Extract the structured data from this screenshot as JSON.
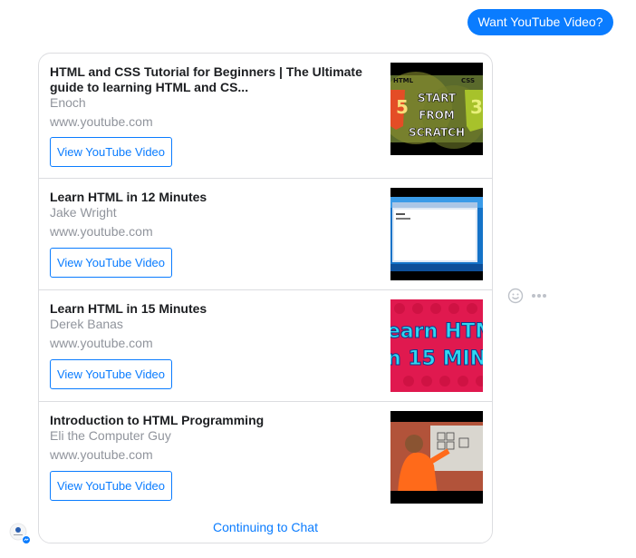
{
  "chat": {
    "outgoing_message": "Want YouTube Video?"
  },
  "card": {
    "items": [
      {
        "title": "HTML and CSS Tutorial for Beginners | The Ultimate guide to learning HTML and CS...",
        "channel": "Enoch",
        "domain": "www.youtube.com",
        "button_label": "View YouTube Video",
        "thumbnail_text": [
          "START",
          "FROM",
          "SCRATCH"
        ]
      },
      {
        "title": "Learn HTML in 12 Minutes",
        "channel": "Jake Wright",
        "domain": "www.youtube.com",
        "button_label": "View YouTube Video"
      },
      {
        "title": "Learn HTML in 15 Minutes",
        "channel": "Derek Banas",
        "domain": "www.youtube.com",
        "button_label": "View YouTube Video",
        "thumbnail_text": [
          "earn HTM",
          "n 15 MIN"
        ]
      },
      {
        "title": "Introduction to HTML Programming",
        "channel": "Eli the Computer Guy",
        "domain": "www.youtube.com",
        "button_label": "View YouTube Video"
      }
    ],
    "footer_label": "Continuing to Chat"
  },
  "icons": {
    "reaction": "smiley-icon",
    "more": "more-options-icon",
    "avatar": "page-avatar-icon"
  },
  "colors": {
    "accent": "#0a7cff",
    "border": "#dcdde0",
    "muted_text": "#90949c",
    "title_text": "#1c1e21"
  }
}
